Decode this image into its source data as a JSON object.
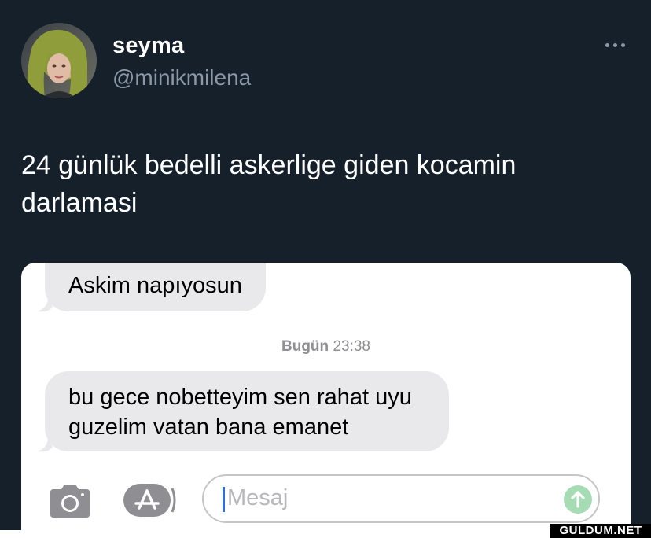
{
  "post": {
    "author_name": "seyma",
    "author_handle": "@minikmilena",
    "text_line1": "24 günlük bedelli askerlige giden kocamin",
    "text_line2": "darlamasi",
    "more_icon": "more-horizontal-icon"
  },
  "messages": {
    "bubble1": "Askim napıyosun",
    "timestamp_day": "Bugün",
    "timestamp_time": "23:38",
    "bubble2_line1": "bu gece nobetteyim sen rahat uyu",
    "bubble2_line2": "guzelim vatan bana emanet"
  },
  "compose": {
    "placeholder": "Mesaj",
    "camera_icon": "camera-icon",
    "apps_icon": "app-store-icon",
    "send_icon": "send-arrow-up-icon"
  },
  "watermark": "GULDUM.NET",
  "colors": {
    "background": "#15202b",
    "handle": "#8b98a5",
    "bubble": "#e9e9eb",
    "send": "#a5dcb3"
  }
}
